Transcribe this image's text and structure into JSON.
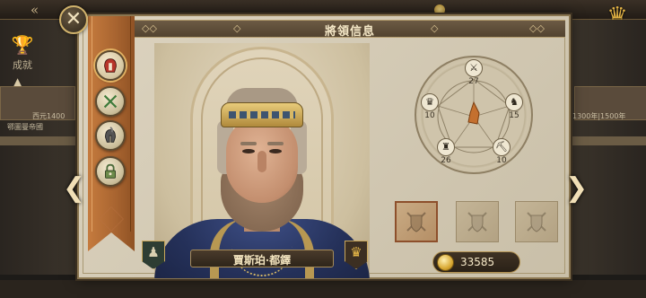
{
  "dialog": {
    "title": "將領信息",
    "close_icon": "close-icon",
    "sidebar": [
      {
        "icon": "warrior-helmet-icon",
        "active": true
      },
      {
        "icon": "crossed-swords-icon",
        "active": false
      },
      {
        "icon": "spartan-helmet-icon",
        "active": false
      },
      {
        "icon": "locked-skill-icon",
        "active": false
      }
    ]
  },
  "general": {
    "name": "賈斯珀·都鐸",
    "left_badge_icon": "pawn-icon",
    "right_badge_icon": "crown-icon"
  },
  "stats": {
    "items": [
      {
        "icon": "crossed-swords-icon",
        "value": "27"
      },
      {
        "icon": "knight-icon",
        "value": "15"
      },
      {
        "icon": "pickaxe-icon",
        "value": "10"
      },
      {
        "icon": "castle-icon",
        "value": "26"
      },
      {
        "icon": "crown-icon",
        "value": "10"
      }
    ]
  },
  "equipment": {
    "slots": [
      {
        "icon": "shield-swords-icon",
        "equipped": true
      },
      {
        "icon": "shield-swords-icon",
        "equipped": false
      },
      {
        "icon": "shield-swords-icon",
        "equipped": false
      }
    ]
  },
  "currency": {
    "gold_value": "33585",
    "icon": "gold-coin-icon"
  },
  "background": {
    "achievement_label": "成就",
    "left_caption": "鄂圖曼帝國",
    "left_year": "西元1400",
    "right_year": "1300年|1500年"
  }
}
